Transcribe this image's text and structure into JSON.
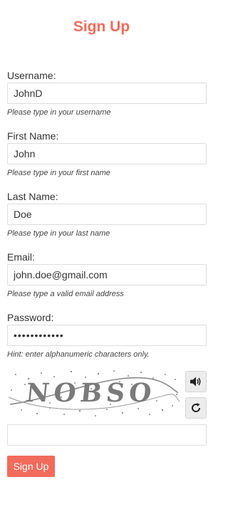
{
  "title": "Sign Up",
  "fields": {
    "username": {
      "label": "Username:",
      "value": "JohnD",
      "help": "Please type in your username"
    },
    "first_name": {
      "label": "First Name:",
      "value": "John",
      "help": "Please type in your first name"
    },
    "last_name": {
      "label": "Last Name:",
      "value": "Doe",
      "help": "Please type in your last name"
    },
    "email": {
      "label": "Email:",
      "value": "john.doe@gmail.com",
      "help": "Please type a valid email address"
    },
    "password": {
      "label": "Password:",
      "value": "••••••••••••",
      "help": "Hint: enter alphanumeric characters only."
    }
  },
  "captcha": {
    "text": "NOBSO",
    "audio_icon": "speaker-icon",
    "refresh_icon": "refresh-icon",
    "input_value": ""
  },
  "submit_label": "Sign Up",
  "colors": {
    "accent": "#f26b5b",
    "border": "#dddddd",
    "captcha_text": "#7a7a7a"
  }
}
